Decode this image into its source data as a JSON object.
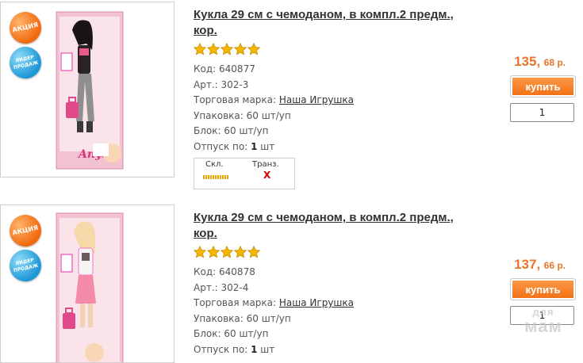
{
  "colors": {
    "accent_orange": "#e8742a",
    "button_orange": "#f06e13",
    "badge_blue": "#1c96d6",
    "stock_bar": "#e6a400",
    "no_stock_red": "#d00000"
  },
  "products": [
    {
      "title": "Кукла 29 см с чемоданом, в компл.2 предм., кор.",
      "badges": {
        "sale": "АКЦИЯ",
        "leader": "ЛИДЕР ПРОДАЖ"
      },
      "rating": 5,
      "code_label": "Код:",
      "code": "640877",
      "art_label": "Арт.:",
      "art": "302-3",
      "brand_label": "Торговая марка:",
      "brand": "Наша Игрушка",
      "pack_label": "Упаковка:",
      "pack": "60 шт/уп",
      "block_label": "Блок:",
      "block": "60 шт/уп",
      "release_label": "Отпуск по:",
      "release_qty": "1",
      "release_unit": "шт",
      "stock": {
        "warehouse_label": "Скл.",
        "transit_label": "Транз.",
        "transit_value": "X"
      },
      "price_rub": "135,",
      "price_kop": "68 р.",
      "buy_label": "купить",
      "quantity": "1",
      "photo_icon": "doll-box-photo"
    },
    {
      "title": "Кукла 29 см с чемоданом, в компл.2 предм., кор.",
      "badges": {
        "sale": "АКЦИЯ",
        "leader": "ЛИДЕР ПРОДАЖ"
      },
      "rating": 5,
      "code_label": "Код:",
      "code": "640878",
      "art_label": "Арт.:",
      "art": "302-4",
      "brand_label": "Торговая марка:",
      "brand": "Наша Игрушка",
      "pack_label": "Упаковка:",
      "pack": "60 шт/уп",
      "block_label": "Блок:",
      "block": "60 шт/уп",
      "release_label": "Отпуск по:",
      "release_qty": "1",
      "release_unit": "шт",
      "price_rub": "137,",
      "price_kop": "66 р.",
      "buy_label": "купить",
      "quantity": "1",
      "photo_icon": "doll-box-photo"
    }
  ],
  "watermark": {
    "line1": "для",
    "line2": "мам"
  }
}
